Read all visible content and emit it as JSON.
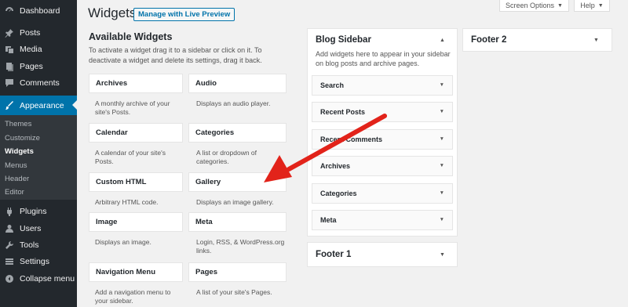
{
  "admin_menu": {
    "dashboard": "Dashboard",
    "posts": "Posts",
    "media": "Media",
    "pages": "Pages",
    "comments": "Comments",
    "appearance": "Appearance",
    "submenu": [
      "Themes",
      "Customize",
      "Widgets",
      "Menus",
      "Header",
      "Editor"
    ],
    "plugins": "Plugins",
    "users": "Users",
    "tools": "Tools",
    "settings": "Settings",
    "collapse": "Collapse menu"
  },
  "header": {
    "title": "Widgets",
    "live_preview": "Manage with Live Preview",
    "screen_options": "Screen Options",
    "help": "Help"
  },
  "available": {
    "title": "Available Widgets",
    "description": "To activate a widget drag it to a sidebar or click on it. To deactivate a widget and delete its settings, drag it back.",
    "widgets": [
      {
        "name": "Archives",
        "desc": "A monthly archive of your site's Posts."
      },
      {
        "name": "Audio",
        "desc": "Displays an audio player."
      },
      {
        "name": "Calendar",
        "desc": "A calendar of your site's Posts."
      },
      {
        "name": "Categories",
        "desc": "A list or dropdown of categories."
      },
      {
        "name": "Custom HTML",
        "desc": "Arbitrary HTML code."
      },
      {
        "name": "Gallery",
        "desc": "Displays an image gallery."
      },
      {
        "name": "Image",
        "desc": "Displays an image."
      },
      {
        "name": "Meta",
        "desc": "Login, RSS, & WordPress.org links."
      },
      {
        "name": "Navigation Menu",
        "desc": "Add a navigation menu to your sidebar."
      },
      {
        "name": "Pages",
        "desc": "A list of your site's Pages."
      }
    ]
  },
  "blog_sidebar": {
    "title": "Blog Sidebar",
    "description": "Add widgets here to appear in your sidebar on blog posts and archive pages.",
    "widgets": [
      "Search",
      "Recent Posts",
      "Recent Comments",
      "Archives",
      "Categories",
      "Meta"
    ]
  },
  "footer1": {
    "title": "Footer 1"
  },
  "footer2": {
    "title": "Footer 2"
  },
  "colors": {
    "accent": "#0073aa",
    "sidebar_bg": "#23282d",
    "arrow": "#e2231a"
  }
}
